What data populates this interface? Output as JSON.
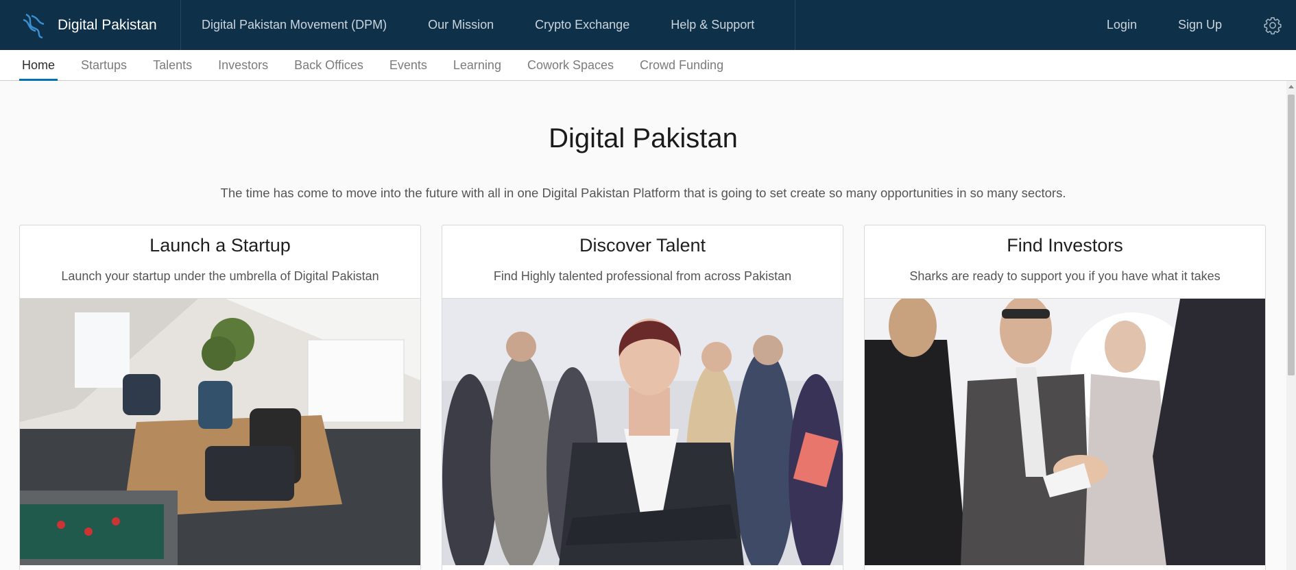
{
  "brand": {
    "name": "Digital Pakistan",
    "logo_icon": "dna-logo-icon"
  },
  "topnav": {
    "items": [
      "Digital Pakistan Movement (DPM)",
      "Our Mission",
      "Crypto Exchange",
      "Help & Support"
    ],
    "login": "Login",
    "signup": "Sign Up",
    "settings_icon": "gear-icon"
  },
  "subnav": {
    "active_index": 0,
    "items": [
      "Home",
      "Startups",
      "Talents",
      "Investors",
      "Back Offices",
      "Events",
      "Learning",
      "Cowork Spaces",
      "Crowd Funding"
    ]
  },
  "hero": {
    "title": "Digital Pakistan",
    "subtitle": "The time has come to move into the future with all in one Digital Pakistan Platform that is going to set create so many opportunities in so many sectors."
  },
  "cards": [
    {
      "title": "Launch a Startup",
      "text": "Launch your startup under the umbrella of Digital Pakistan",
      "image": "startup-office-photo"
    },
    {
      "title": "Discover Talent",
      "text": "Find Highly talented professional from across Pakistan",
      "image": "talent-team-photo"
    },
    {
      "title": "Find Investors",
      "text": "Sharks are ready to support you if you have what it takes",
      "image": "investors-handshake-photo"
    }
  ],
  "colors": {
    "header_bg": "#0f3049",
    "accent": "#0073b3"
  }
}
